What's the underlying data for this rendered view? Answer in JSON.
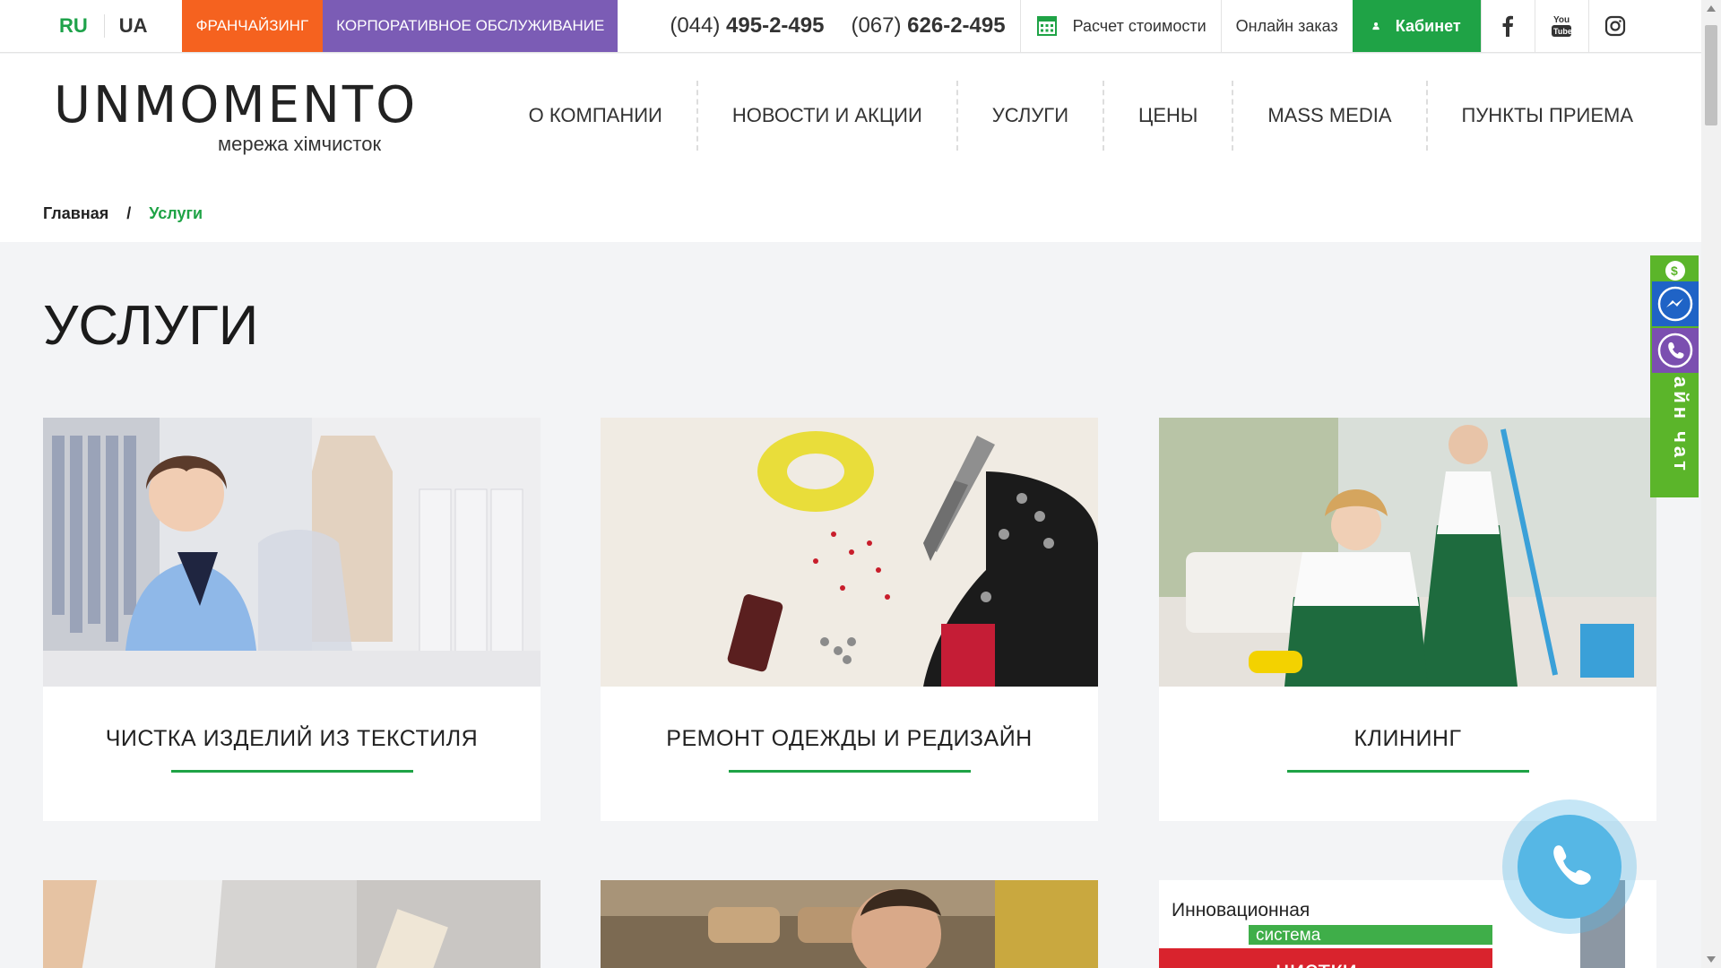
{
  "topbar": {
    "lang_ru": "RU",
    "lang_ua": "UA",
    "franchising": "ФРАНЧАЙЗИНГ",
    "corporate": "КОРПОРАТИВНОЕ ОБСЛУЖИВАНИЕ",
    "phone1_code": "(044)",
    "phone1_num": "495-2-495",
    "phone2_code": "(067)",
    "phone2_num": "626-2-495",
    "calc_label": "Расчет стоимости",
    "order_label": "Онлайн заказ",
    "cabinet_label": "Кабинет",
    "social": [
      "facebook-icon",
      "youtube-icon",
      "instagram-icon"
    ]
  },
  "header": {
    "logo_main": "UNMOMENTO",
    "logo_sub": "мережа хімчисток",
    "nav": [
      "О КОМПАНИИ",
      "НОВОСТИ И АКЦИИ",
      "УСЛУГИ",
      "ЦЕНЫ",
      "MASS MEDIA",
      "ПУНКТЫ ПРИЕМА"
    ],
    "breadcrumb": {
      "home": "Главная",
      "sep": "/",
      "current": "Услуги"
    }
  },
  "main": {
    "title": "УСЛУГИ",
    "cards": [
      {
        "label": "ЧИСТКА ИЗДЕЛИЙ ИЗ ТЕКСТИЛЯ"
      },
      {
        "label": "РЕМОНТ ОДЕЖДЫ И РЕДИЗАЙН"
      },
      {
        "label": "КЛИНИНГ"
      }
    ],
    "bottom_card_text": [
      "Инновационная",
      "система",
      "чистки"
    ]
  },
  "widgets": {
    "chat_text": "айн чат"
  },
  "colors": {
    "accent_green": "#1fa346",
    "franchise_orange": "#f5621f",
    "corporate_purple": "#7b5cb5",
    "chat_green": "#5bb52a",
    "call_blue": "#56b7e5"
  }
}
